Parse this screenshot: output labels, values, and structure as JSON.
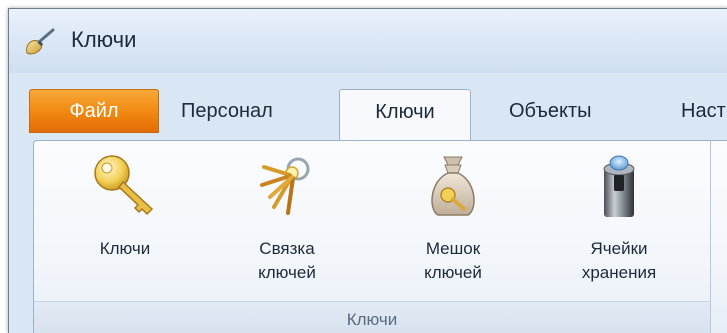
{
  "window": {
    "title": "Ключи"
  },
  "ribbon": {
    "tabs": [
      {
        "label": "Файл",
        "type": "file"
      },
      {
        "label": "Персонал",
        "type": "normal"
      },
      {
        "label": "Ключи",
        "type": "active"
      },
      {
        "label": "Объекты",
        "type": "normal"
      },
      {
        "label": "Наст",
        "type": "normal"
      }
    ],
    "group": {
      "label": "Ключи",
      "buttons": [
        {
          "label": "Ключи",
          "icon": "key-icon"
        },
        {
          "label": "Связка\nключей",
          "icon": "key-bunch-icon"
        },
        {
          "label": "Мешок\nключей",
          "icon": "key-bag-icon"
        },
        {
          "label": "Ячейки\nхранения",
          "icon": "storage-cell-icon"
        }
      ]
    }
  }
}
